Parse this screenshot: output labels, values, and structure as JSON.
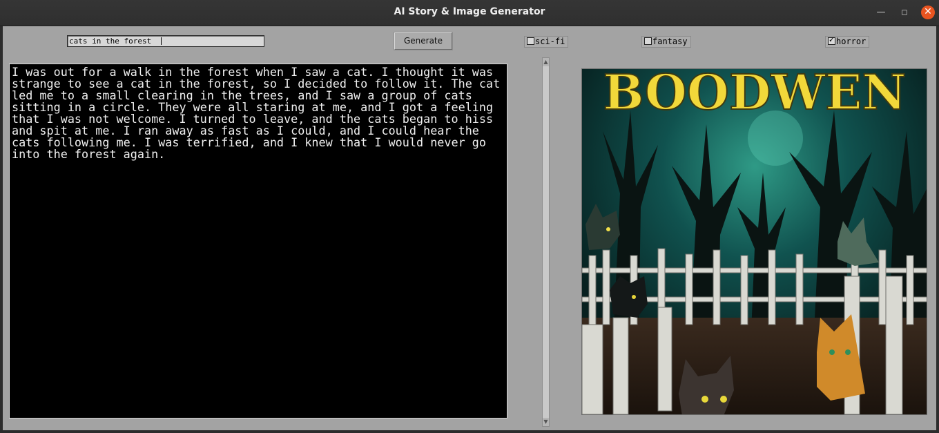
{
  "window": {
    "title": "AI Story & Image Generator"
  },
  "controls": {
    "prompt_value": "cats in the forest ",
    "generate_label": "Generate",
    "genres": [
      {
        "label": "sci-fi",
        "checked": false
      },
      {
        "label": "fantasy",
        "checked": false
      },
      {
        "label": "horror",
        "checked": true
      }
    ]
  },
  "story": {
    "text": "I was out for a walk in the forest when I saw a cat. I thought it was strange to see a cat in the forest, so I decided to follow it. The cat led me to a small clearing in the trees, and I saw a group of cats sitting in a circle. They were all staring at me, and I got a feeling that I was not welcome. I turned to leave, and the cats began to hiss and spit at me. I ran away as fast as I could, and I could hear the cats following me. I was terrified, and I knew that I would never go into the forest again."
  },
  "image": {
    "banner_text": "BOODWEN"
  },
  "colors": {
    "close_button": "#e95420",
    "window_bg": "#a3a3a3",
    "story_bg": "#000000"
  }
}
